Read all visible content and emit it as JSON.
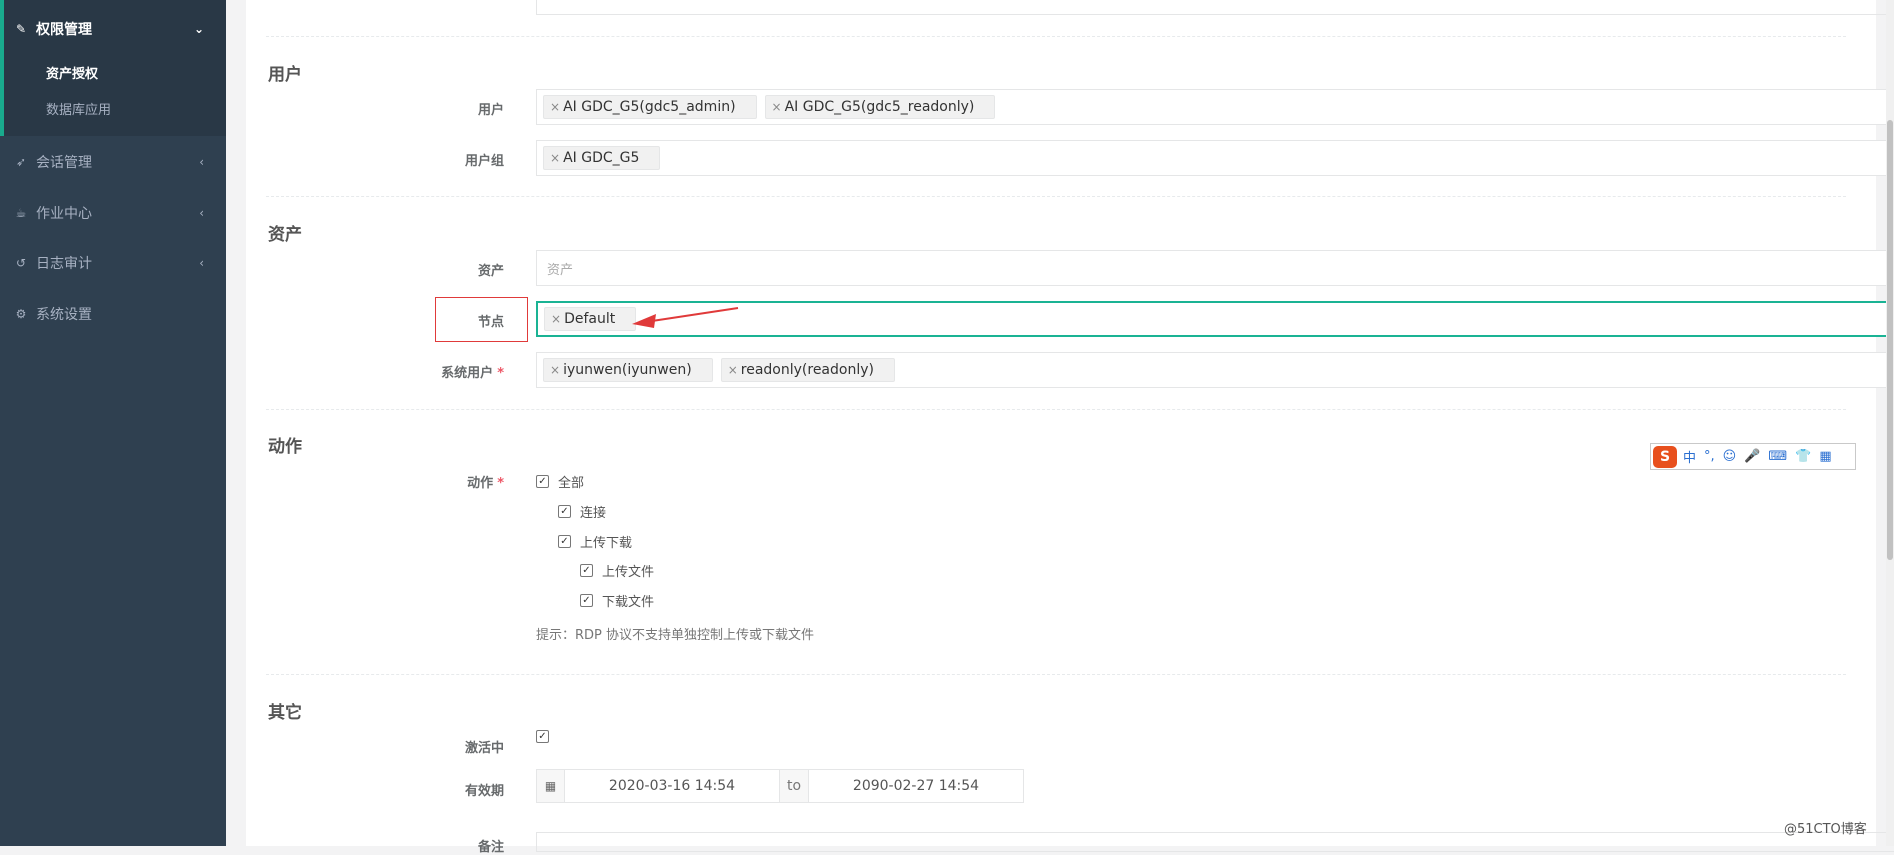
{
  "sidebar": {
    "group": {
      "label": "权限管理",
      "icon": "edit-icon"
    },
    "sub_items": [
      {
        "label": "资产授权",
        "active": true
      },
      {
        "label": "数据库应用",
        "active": false
      }
    ],
    "items": [
      {
        "label": "会话管理",
        "icon": "rocket-icon"
      },
      {
        "label": "作业中心",
        "icon": "coffee-icon"
      },
      {
        "label": "日志审计",
        "icon": "history-icon"
      },
      {
        "label": "系统设置",
        "icon": "cogs-icon"
      }
    ]
  },
  "form": {
    "user_section": {
      "title": "用户",
      "user_label": "用户",
      "users": [
        "AI GDC_G5(gdc5_admin)",
        "AI GDC_G5(gdc5_readonly)"
      ],
      "group_label": "用户组",
      "groups": [
        "AI GDC_G5"
      ]
    },
    "asset_section": {
      "title": "资产",
      "asset_label": "资产",
      "asset_placeholder": "资产",
      "node_label": "节点",
      "nodes": [
        "Default"
      ],
      "sysuser_label": "系统用户",
      "sysusers": [
        "iyunwen(iyunwen)",
        "readonly(readonly)"
      ]
    },
    "action_section": {
      "title": "动作",
      "label": "动作",
      "options": [
        {
          "label": "全部",
          "level": 0,
          "checked": true
        },
        {
          "label": "连接",
          "level": 1,
          "checked": true
        },
        {
          "label": "上传下载",
          "level": 1,
          "checked": true
        },
        {
          "label": "上传文件",
          "level": 2,
          "checked": true
        },
        {
          "label": "下载文件",
          "level": 2,
          "checked": true
        }
      ],
      "hint": "提示：RDP 协议不支持单独控制上传或下载文件"
    },
    "other_section": {
      "title": "其它",
      "active_label": "激活中",
      "active_checked": true,
      "validity_label": "有效期",
      "date_start": "2020-03-16 14:54",
      "date_to": "to",
      "date_end": "2090-02-27 14:54",
      "comment_label": "备注"
    },
    "required_mark": "*",
    "remove_mark": "×"
  },
  "ime_toolbar": {
    "logo": "S",
    "items": [
      "中",
      "°,",
      "☺",
      "🎤",
      "⌨",
      "👕",
      "▦"
    ]
  },
  "watermark": "@51CTO博客"
}
